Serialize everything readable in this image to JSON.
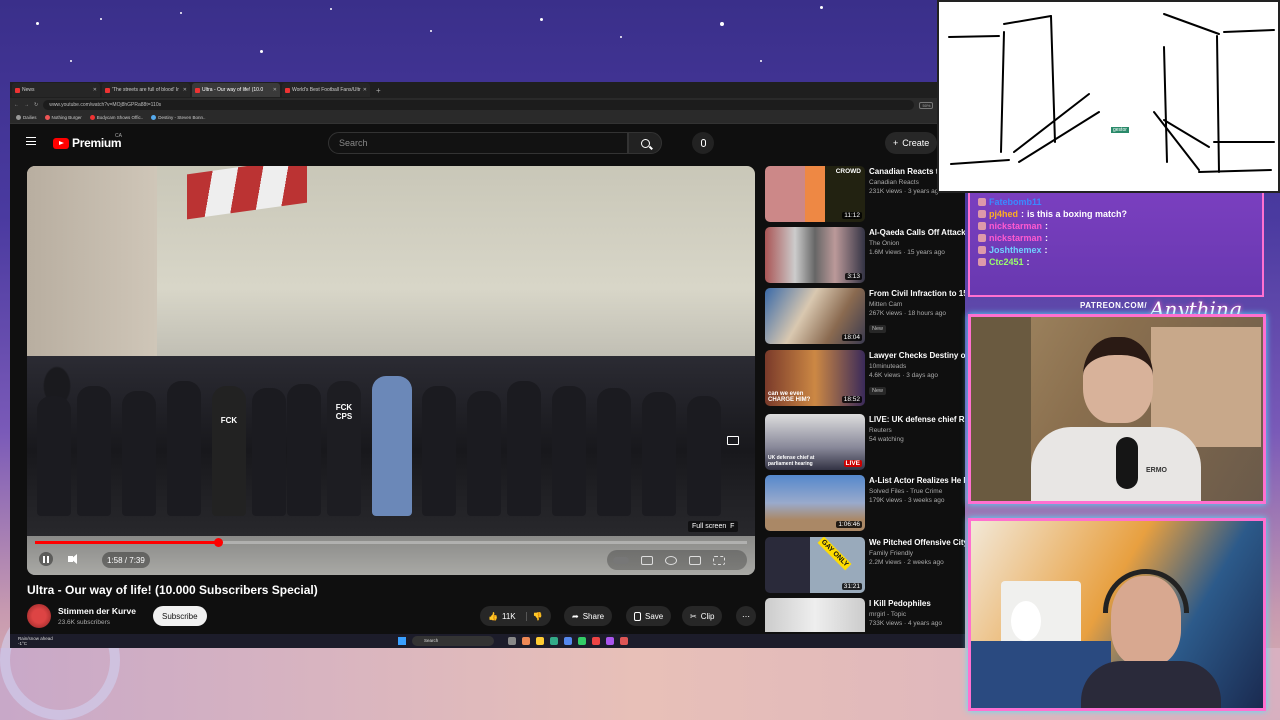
{
  "browser": {
    "tabs": [
      {
        "label": "News",
        "active": false
      },
      {
        "label": "'The streets are full of blood' Ir",
        "active": false
      },
      {
        "label": "Ultra - Our way of life! (10.0",
        "active": true
      },
      {
        "label": "World's Best Football Fans/Ultr",
        "active": false
      }
    ],
    "url": "www.youtube.com/watch?v=MOj8hGPRa88t=110s",
    "zoom": "50%",
    "bookmarks": [
      "Dailies",
      "Nothing Burger",
      "Bodycam Shows Offic..",
      "Destiny - Steven Bonn.."
    ]
  },
  "youtube": {
    "logo": "Premium",
    "country": "CA",
    "search_placeholder": "Search",
    "create_label": "Create",
    "video": {
      "title": "Ultra - Our way of life! (10.000 Subscribers Special)",
      "time": "1:58 / 7:39",
      "progress": 0.257,
      "tooltip": "Full screen",
      "tooltip_key": "F",
      "overlay_text_1": "FCK",
      "overlay_text_2": "CPS"
    },
    "channel": {
      "name": "Stimmen der Kurve",
      "subs": "23.6K subscribers",
      "subscribe": "Subscribe"
    },
    "actions": {
      "likes": "11K",
      "share": "Share",
      "save": "Save",
      "clip": "Clip"
    },
    "recommendations": [
      {
        "title": "Canadian Reacts to ULTRA'S WAY OF LIFE! (Cre",
        "channel": "Canadian Reacts",
        "meta": "231K views · 3 years ago",
        "duration": "11:12",
        "thumb_text": "CROWD",
        "badge": ""
      },
      {
        "title": "Al-Qaeda Calls Off Attack On Nation's Capitol To Spare L",
        "channel": "The Onion",
        "meta": "1.6M views · 15 years ago",
        "duration": "3:13",
        "thumb_text": "",
        "badge": ""
      },
      {
        "title": "From Civil Infraction to 15 in Prison",
        "channel": "Mitten Cam",
        "meta": "267K views · 18 hours ago",
        "duration": "18:04",
        "thumb_text": "",
        "badge": "New"
      },
      {
        "title": "Lawyer Checks Destiny on Legality of the Minneapoli",
        "channel": "10minuteads",
        "meta": "4.6K views · 3 days ago",
        "duration": "18:52",
        "thumb_text": "can we even CHARGE HIM?",
        "badge": "New"
      },
      {
        "title": "LIVE: UK defense chief Ri Knighton at parliament he",
        "channel": "Reuters",
        "meta": "54 watching",
        "duration": "LIVE",
        "thumb_text": "UK defense chief at parliament hearing",
        "badge": ""
      },
      {
        "title": "A-List Actor Realizes He Murdered Director On Set",
        "channel": "Solved Files - True Crime",
        "meta": "179K views · 3 weeks ago",
        "duration": "1:06:46",
        "thumb_text": "",
        "badge": ""
      },
      {
        "title": "We Pitched Offensive City To Locals (again)",
        "channel": "Family Friendly",
        "meta": "2.2M views · 2 weeks ago",
        "duration": "31:21",
        "thumb_text": "GAY ONLY",
        "badge": ""
      },
      {
        "title": "I Kill Pedophiles",
        "channel": "mrgirl - Topic",
        "meta": "733K views · 4 years ago",
        "duration": "",
        "thumb_text": "",
        "badge": ""
      }
    ]
  },
  "taskbar": {
    "weather_1": "Rain/snow ahead",
    "weather_2": "-1°C",
    "search": "Search"
  },
  "stream": {
    "drawing_tag": "gestor",
    "chat": [
      {
        "user": "Fatebomb11",
        "msg": ""
      },
      {
        "user": "pj4hed",
        "msg": "is this a boxing match?"
      },
      {
        "user": "nickstarman",
        "msg": ""
      },
      {
        "user": "nickstarman",
        "msg": ""
      },
      {
        "user": "Joshthemex",
        "msg": ""
      },
      {
        "user": "Ctc2451",
        "msg": ""
      }
    ],
    "patreon": "PATREON.COM/",
    "signature": "Anything Goes",
    "cam1_shirt": "ERMO",
    "colors": {
      "chat_bg": "#7a3fbf",
      "frame": "#ff70d0",
      "glow": "#50e0ff",
      "yt_red": "#ff0000"
    }
  }
}
